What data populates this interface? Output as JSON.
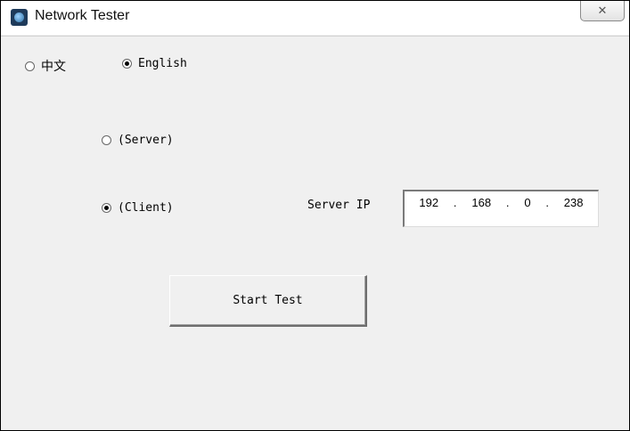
{
  "window": {
    "title": "Network Tester",
    "close_glyph": "✕"
  },
  "language": {
    "chinese_label": "中文",
    "english_label": "English",
    "selected": "English"
  },
  "mode": {
    "server_label": "(Server)",
    "client_label": "(Client)",
    "selected": "Client"
  },
  "server_ip": {
    "label": "Server IP",
    "octets": [
      "192",
      "168",
      "0",
      "238"
    ],
    "separator": "."
  },
  "start_button": {
    "label": "Start Test"
  }
}
